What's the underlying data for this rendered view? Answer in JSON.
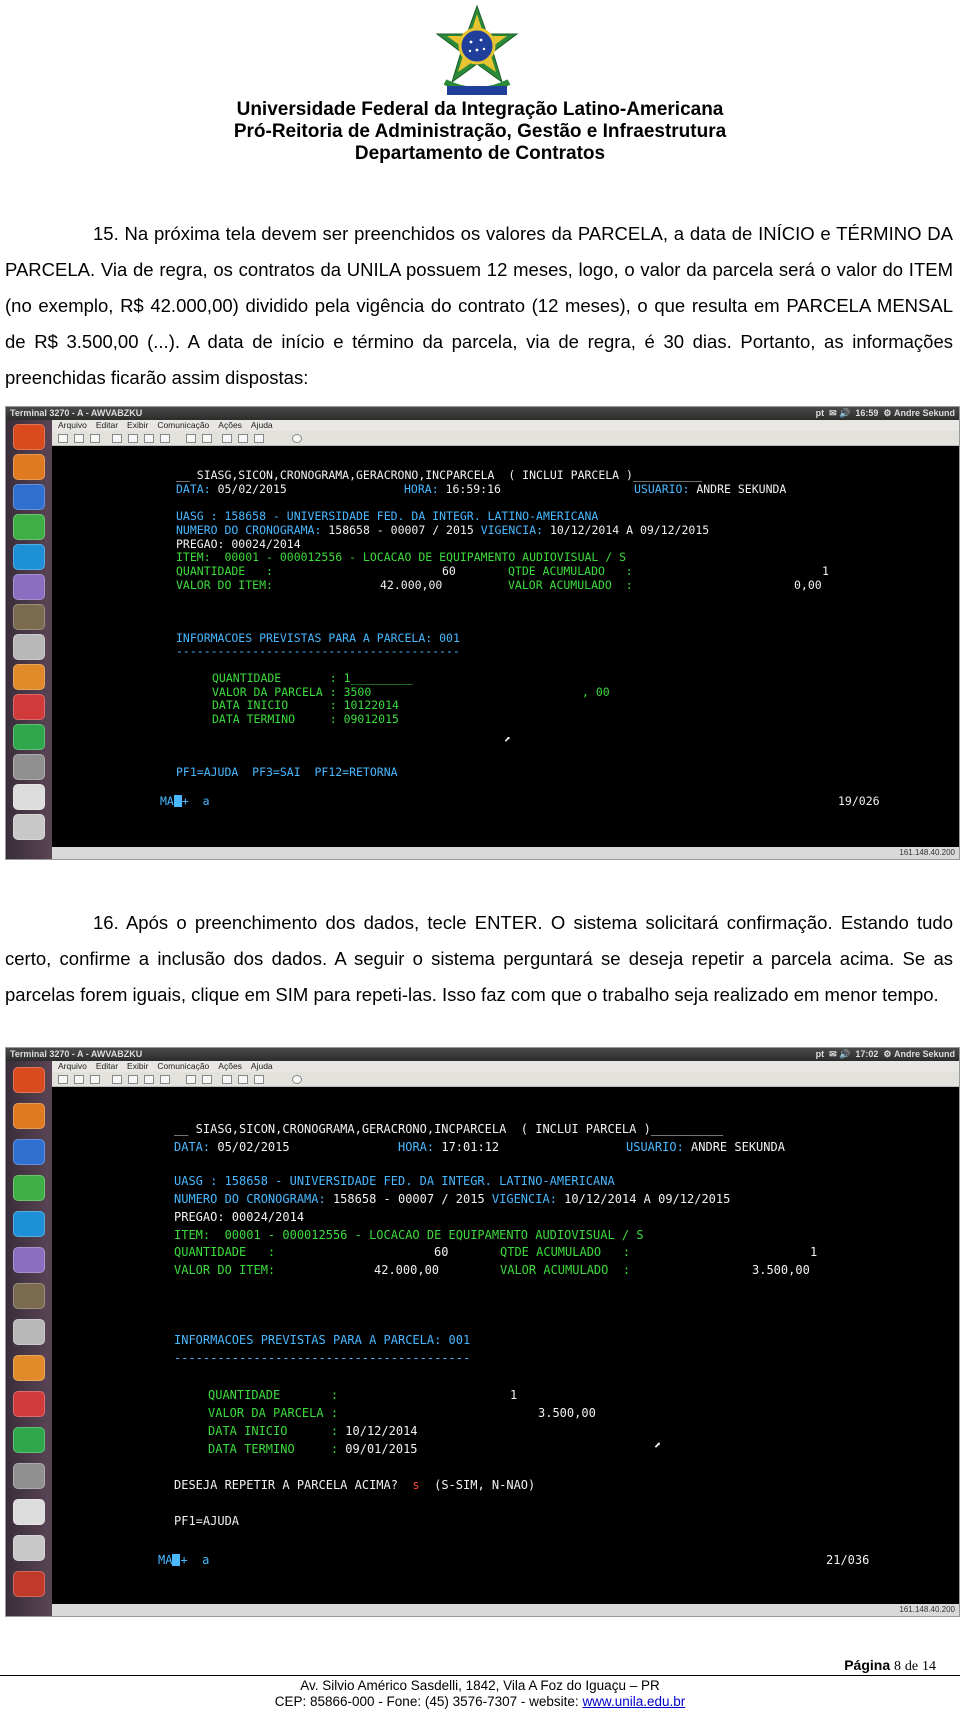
{
  "header": {
    "line1": "Universidade Federal da Integração Latino-Americana",
    "line2": "Pró-Reitoria de Administração, Gestão e Infraestrutura",
    "line3": "Departamento de Contratos"
  },
  "para15": {
    "text": "15. Na próxima tela devem ser preenchidos os valores da PARCELA, a data de INÍCIO e TÉRMINO DA PARCELA. Via de regra, os contratos da UNILA possuem 12 meses, logo, o valor da parcela será o valor do ITEM (no exemplo, R$ 42.000,00) dividido pela vigência do contrato (12 meses), o que resulta em PARCELA MENSAL de R$ 3.500,00 (...). A data de início e término da parcela, via de regra, é 30 dias. Portanto, as informações preenchidas ficarão assim dispostas:"
  },
  "para16": {
    "text": "16. Após o preenchimento dos dados, tecle ENTER. O sistema solicitará confirmação. Estando tudo certo, confirme a inclusão dos dados. A seguir o sistema perguntará se deseja repetir a parcela acima. Se as parcelas forem iguais, clique em SIM para repeti-las. Isso faz com que o trabalho seja realizado em menor tempo."
  },
  "window": {
    "title": "Terminal 3270 - A - AWVABZKU",
    "menu": [
      "Arquivo",
      "Editar",
      "Exibir",
      "Comunicação",
      "Ações",
      "Ajuda"
    ],
    "lang": "pt",
    "user": "Andre Sekund",
    "ip": "161.148.40.200"
  },
  "shot1": {
    "time": "16:59",
    "cmd": "__ SIASG,SICON,CRONOGRAMA,GERACRONO,INCPARCELA  ( INCLUI PARCELA )__________",
    "data_label": "DATA:",
    "data": "05/02/2015",
    "hora_label": "HORA:",
    "hora": "16:59:16",
    "usuario_label": "USUARIO:",
    "usuario": "ANDRE SEKUNDA",
    "uasg": "UASG : 158658 - UNIVERSIDADE FED. DA INTEGR. LATINO-AMERICANA",
    "crono_label": "NUMERO DO CRONOGRAMA:",
    "crono": "158658 - 00007 / 2015",
    "vig_label": "VIGENCIA:",
    "vig": "10/12/2014 A 09/12/2015",
    "pregao": "PREGAO: 00024/2014",
    "item": "ITEM:  00001 - 000012556 - LOCACAO DE EQUIPAMENTO AUDIOVISUAL / S",
    "qtd_label": "QUANTIDADE   :",
    "qtd": "60",
    "qtdac_label": "QTDE ACUMULADO   :",
    "qtdac": "1",
    "vitem_label": "VALOR DO ITEM:",
    "vitem": "42.000,00",
    "vac_label": "VALOR ACUMULADO  :",
    "vac": "0,00",
    "info": "INFORMACOES PREVISTAS PARA A PARCELA: 001",
    "dashes": "-----------------------------------------",
    "f_qtd_label": "QUANTIDADE       :",
    "f_qtd": "1_________",
    "f_valor_label": "VALOR DA PARCELA :",
    "f_valor": "3500",
    "f_cents": ", 00",
    "f_ini_label": "DATA INICIO      :",
    "f_ini": "10122014",
    "f_fim_label": "DATA TERMINO     :",
    "f_fim": "09012015",
    "pf": "PF1=AJUDA  PF3=SAI  PF12=RETORNA",
    "status_left": "MA",
    "status_mid": "+  a",
    "status_right": "19/026"
  },
  "shot2": {
    "time": "17:02",
    "cmd": "__ SIASG,SICON,CRONOGRAMA,GERACRONO,INCPARCELA  ( INCLUI PARCELA )__________",
    "data_label": "DATA:",
    "data": "05/02/2015",
    "hora_label": "HORA:",
    "hora": "17:01:12",
    "usuario_label": "USUARIO:",
    "usuario": "ANDRE SEKUNDA",
    "uasg": "UASG : 158658 - UNIVERSIDADE FED. DA INTEGR. LATINO-AMERICANA",
    "crono_label": "NUMERO DO CRONOGRAMA:",
    "crono": "158658 - 00007 / 2015",
    "vig_label": "VIGENCIA:",
    "vig": "10/12/2014 A 09/12/2015",
    "pregao": "PREGAO: 00024/2014",
    "item": "ITEM:  00001 - 000012556 - LOCACAO DE EQUIPAMENTO AUDIOVISUAL / S",
    "qtd_label": "QUANTIDADE   :",
    "qtd": "60",
    "qtdac_label": "QTDE ACUMULADO   :",
    "qtdac": "1",
    "vitem_label": "VALOR DO ITEM:",
    "vitem": "42.000,00",
    "vac_label": "VALOR ACUMULADO  :",
    "vac": "3.500,00",
    "info": "INFORMACOES PREVISTAS PARA A PARCELA: 001",
    "dashes": "-----------------------------------------",
    "f_qtd_label": "QUANTIDADE       :",
    "f_qtd": "1",
    "f_valor_label": "VALOR DA PARCELA :",
    "f_valor": "3.500,00",
    "f_ini_label": "DATA INICIO      :",
    "f_ini": "10/12/2014",
    "f_fim_label": "DATA TERMINO     :",
    "f_fim": "09/01/2015",
    "repetir_label": "DESEJA REPETIR A PARCELA ACIMA?",
    "repetir_val": "s",
    "repetir_opts": "(S-SIM, N-NAO)",
    "pf": "PF1=AJUDA",
    "status_left": "MA",
    "status_mid": "+  a",
    "status_right": "21/036"
  },
  "footer": {
    "page_label": "Página",
    "page_num": "8",
    "page_of": "de",
    "page_total": "14",
    "address": "Av. Silvio Américo Sasdelli, 1842, Vila A Foz do Iguaçu – PR",
    "contact": "CEP: 85866-000 - Fone: (45) 3576-7307 - website:",
    "website": "www.unila.edu.br"
  }
}
